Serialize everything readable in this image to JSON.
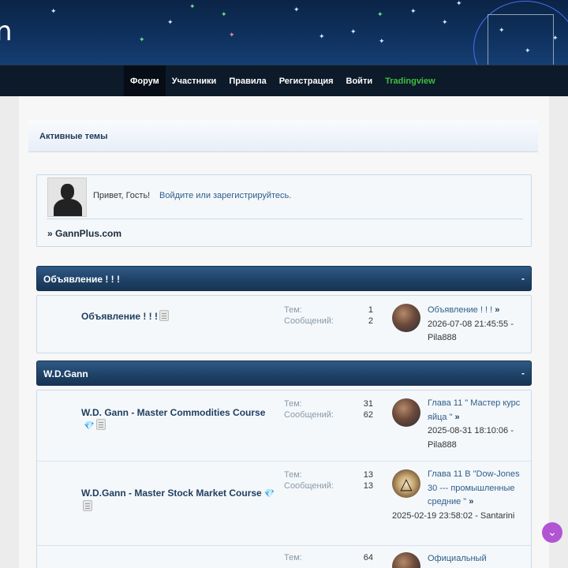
{
  "header": {
    "logo_fragment": "n"
  },
  "nav": {
    "items": [
      "Форум",
      "Участники",
      "Правила",
      "Регистрация",
      "Войти",
      "Tradingview"
    ]
  },
  "active_topics": "Активные темы",
  "welcome": {
    "greeting": "Привет, Гость!",
    "login_text": "Войдите или зарегистрируйтесь.",
    "site_link": "» GannPlus.com"
  },
  "categories": [
    {
      "title": "Объявление ! ! !",
      "collapse": "-"
    },
    {
      "title": "W.D.Gann",
      "collapse": "-"
    }
  ],
  "forums": [
    {
      "name": "Объявление ! ! !",
      "topics_label": "Тем:",
      "topics": "1",
      "posts_label": "Сообщений:",
      "posts": "2",
      "last_title": "Объявление ! ! !",
      "last_arrow": "»",
      "last_meta": "2026-07-08 21:45:55 - Pila888"
    },
    {
      "name": "W.D. Gann - Master Commodities Course",
      "topics_label": "Тем:",
      "topics": "31",
      "posts_label": "Сообщений:",
      "posts": "62",
      "last_title": "Глава 11 \" Мастер курс яйца \"",
      "last_arrow": "»",
      "last_meta": "2025-08-31 18:10:06 - Pila888"
    },
    {
      "name": "W.D.Gann - Master Stock Market Course",
      "topics_label": "Тем:",
      "topics": "13",
      "posts_label": "Сообщений:",
      "posts": "13",
      "last_title": "Глава 11 В \"Dow-Jones 30 --- промышленные средние \"",
      "last_arrow": "»",
      "last_meta": "2025-02-19 23:58:02 - Santarini"
    },
    {
      "topics_label": "Тем:",
      "topics": "64",
      "last_title": "Официальный"
    }
  ],
  "scroll_button_icon": "chevron-down-icon",
  "colors": {
    "header_bg": "#0f3260",
    "nav_bg": "#0d1a2a",
    "category_bar": "#1f4268",
    "tradingview_link": "#3fbf3f",
    "scroll_button": "#b155d4"
  }
}
